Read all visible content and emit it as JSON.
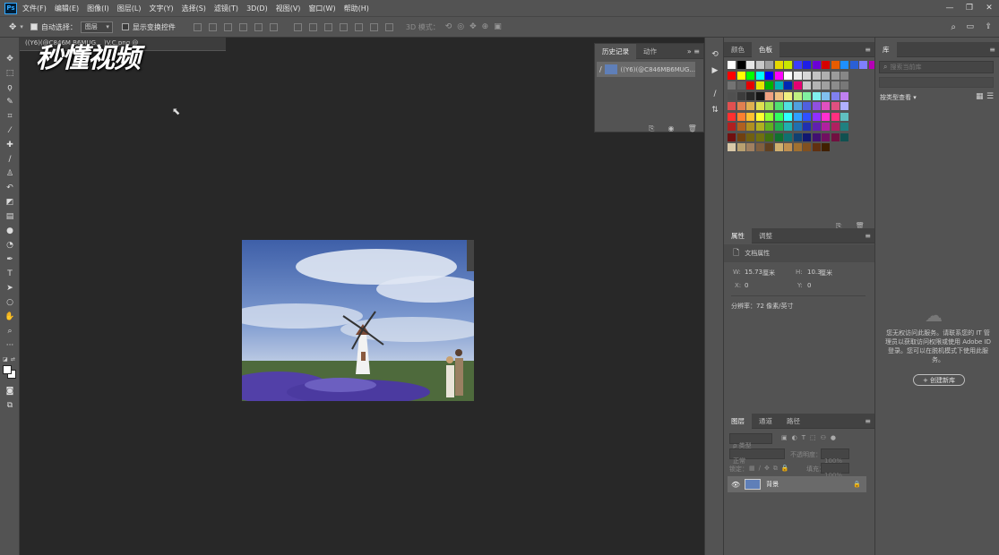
{
  "menubar": {
    "logo": "Ps",
    "items": [
      "文件(F)",
      "编辑(E)",
      "图像(I)",
      "图层(L)",
      "文字(Y)",
      "选择(S)",
      "滤镜(T)",
      "3D(D)",
      "视图(V)",
      "窗口(W)",
      "帮助(H)"
    ]
  },
  "options": {
    "auto_select_label": "自动选择：",
    "auto_select_value": "图层",
    "show_transform_label": "显示变换控件",
    "mode_3d_label": "3D 模式："
  },
  "document": {
    "tab_label": "((Y6)(@C846M B6MUG... )V.C.png @",
    "watermark": "秒懂视频"
  },
  "history_panel": {
    "tab_history": "历史记录",
    "tab_actions": "动作",
    "snapshot_label": "((Y6)(@C846MB6MUG..."
  },
  "color_panel": {
    "tab_color": "颜色",
    "tab_swatches": "色板"
  },
  "properties_panel": {
    "tab_properties": "属性",
    "tab_adjustments": "调整",
    "doc_props_label": "文档属性",
    "w_label": "W:",
    "w_value": "15.73",
    "w_unit": "厘米",
    "h_label": "H:",
    "h_value": "10.3",
    "h_unit": "厘米",
    "x_label": "X:",
    "x_value": "0",
    "y_label": "Y:",
    "y_value": "0",
    "resolution": "分辨率：72 像素/英寸"
  },
  "layers_panel": {
    "tab_layers": "图层",
    "tab_channels": "通道",
    "tab_paths": "路径",
    "filter_label": "ρ 类型",
    "blend_mode": "正常",
    "opacity_label": "不透明度：",
    "opacity_value": "100%",
    "lock_label": "锁定：",
    "fill_label": "填充：",
    "fill_value": "100%",
    "layer_name": "背景"
  },
  "library_panel": {
    "tab_label": "库",
    "search_placeholder": "搜索当前库",
    "view_by": "按类型查看",
    "message": "您无权访问此服务。请联系您的 IT 管理员以获取访问权限或使用 Adobe ID 登录。您可以在脱机模式下使用此服务。",
    "create_button": "+ 创建新库"
  },
  "colors": {
    "ui_bg": "#535353",
    "canvas_bg": "#282828",
    "accent": "#31a8ff"
  }
}
